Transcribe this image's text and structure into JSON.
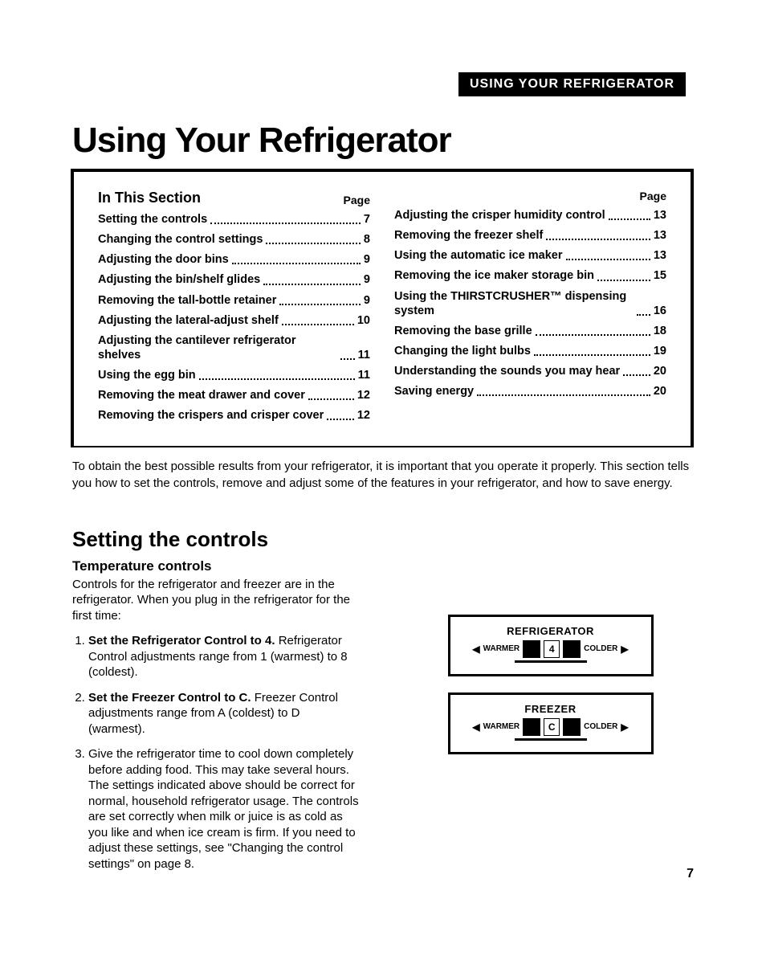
{
  "header_tag": "USING YOUR REFRIGERATOR",
  "title": "Using Your Refrigerator",
  "toc": {
    "section_label": "In This Section",
    "page_label": "Page",
    "left": [
      {
        "text": "Setting the controls",
        "page": "7"
      },
      {
        "text": "Changing the control settings",
        "page": "8"
      },
      {
        "text": "Adjusting the door bins",
        "page": "9"
      },
      {
        "text": "Adjusting the bin/shelf glides",
        "page": "9"
      },
      {
        "text": "Removing the tall-bottle retainer",
        "page": "9"
      },
      {
        "text": "Adjusting the lateral-adjust shelf",
        "page": "10"
      },
      {
        "text": "Adjusting the cantilever refrigerator shelves",
        "page": "11"
      },
      {
        "text": "Using the egg bin",
        "page": "11"
      },
      {
        "text": "Removing the meat drawer and cover",
        "page": "12"
      },
      {
        "text": "Removing the crispers and crisper cover",
        "page": "12"
      }
    ],
    "right": [
      {
        "text": "Adjusting the crisper humidity control",
        "page": "13"
      },
      {
        "text": "Removing the freezer shelf",
        "page": "13"
      },
      {
        "text": "Using the automatic ice maker",
        "page": "13"
      },
      {
        "text": "Removing the ice maker storage bin",
        "page": "15"
      },
      {
        "text": "Using the THIRSTCRUSHER™ dispensing system",
        "page": "16"
      },
      {
        "text": "Removing the base grille",
        "page": "18"
      },
      {
        "text": "Changing the light bulbs",
        "page": "19"
      },
      {
        "text": "Understanding the sounds you may hear",
        "page": "20"
      },
      {
        "text": "Saving energy",
        "page": "20"
      }
    ]
  },
  "intro": "To obtain the best possible results from your refrigerator, it is important that you operate it properly. This section tells you how to set the controls, remove and adjust some of the features in your refrigerator, and how to save energy.",
  "section2": {
    "title": "Setting the controls",
    "subhead": "Temperature controls",
    "lead": "Controls for the refrigerator and freezer are in the refrigerator. When you plug in the refrigerator for the first time:",
    "steps": [
      {
        "bold": "Set the Refrigerator Control to 4.",
        "rest": " Refrigerator Control adjustments range from 1 (warmest) to 8 (coldest)."
      },
      {
        "bold": "Set the Freezer Control to C.",
        "rest": " Freezer Control adjustments range from A (coldest) to D (warmest)."
      },
      {
        "bold": "",
        "rest": "Give the refrigerator time to cool down completely before adding food. This may take several hours.\nThe settings indicated above should be correct for normal, household refrigerator usage. The controls are set correctly when milk or juice is as cold as you like and when ice cream is firm. If you need to adjust these settings, see \"Changing the control settings\" on page 8."
      }
    ]
  },
  "controls": {
    "fridge": {
      "title": "REFRIGERATOR",
      "warmer": "WARMER",
      "value": "4",
      "colder": "COLDER"
    },
    "freezer": {
      "title": "FREEZER",
      "warmer": "WARMER",
      "value": "C",
      "colder": "COLDER"
    }
  },
  "page_number": "7"
}
